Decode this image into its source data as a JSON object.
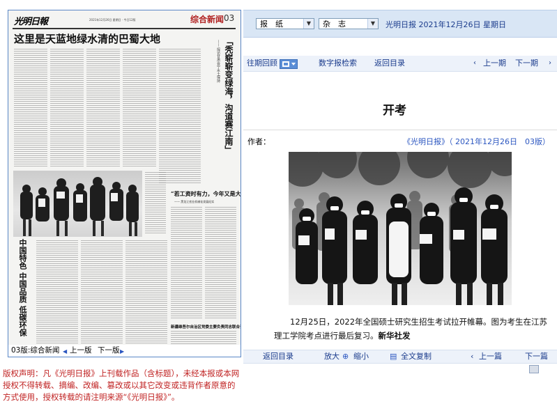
{
  "paper": {
    "logo": "光明日報",
    "meta": "2021年12月26日 星期日 · 今日12版",
    "section": "综合新闻",
    "page_num": "03",
    "headline": "这里是天蓝地绿水清的巴蜀大地",
    "vert_title": "「秃崭崭变绿海，沟道赛江南」",
    "vert_subtitle": "—— 探访甘肃会宁水土保持",
    "mid_headline": "“若工资时有力，今年又是大丰收”",
    "mid_sub": "—— 黑龙江农业机械化发展纪实",
    "vert_left": "中国特色 中国品质 低碳环保",
    "bottom_headline": "新疆维吾尔自治区党委主要负责同志联合调研"
  },
  "paper_nav": {
    "section_label": "03版:综合新闻",
    "prev_label": "上一版",
    "next_label": "下一版"
  },
  "copyright": "版权声明：凡《光明日报》上刊载作品（含标题），未经本报或本网授权不得转载、摘编、改编、篡改或以其它改变或违背作者原意的方式使用，授权转载的请注明来源“《光明日报》”。",
  "toolbar": {
    "select_newspaper": "报　纸",
    "select_magazine": "杂　志",
    "paper_name": "光明日报",
    "date": "2021年12月26日",
    "weekday": "星期日"
  },
  "navbar": {
    "archive": "往期回顾",
    "digital_search": "数字报检索",
    "back_to_index": "返回目录",
    "prev_issue": "上一期",
    "next_issue": "下一期"
  },
  "article": {
    "title": "开考",
    "author_label": "作者：",
    "source": "《光明日报》（ 2021年12月26日　03版）",
    "caption": "12月25日，2022年全国硕士研究生招生考试拉开帷幕。图为考生在江苏理工学院考点进行最后复习。",
    "agency": "新华社发"
  },
  "bottombar": {
    "back_to_index": "返回目录",
    "zoom_in": "放大",
    "zoom_out": "缩小",
    "copy_full": "全文复制",
    "prev_article": "上一篇",
    "next_article": "下一篇"
  }
}
